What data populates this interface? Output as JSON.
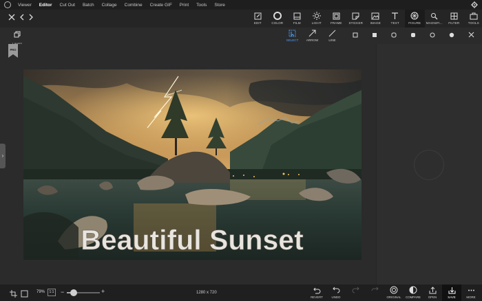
{
  "menu": {
    "items": [
      {
        "label": "Viewer"
      },
      {
        "label": "Editor"
      },
      {
        "label": "Cut Out"
      },
      {
        "label": "Batch"
      },
      {
        "label": "Collage"
      },
      {
        "label": "Combine"
      },
      {
        "label": "Create GIF"
      },
      {
        "label": "Print"
      },
      {
        "label": "Tools"
      },
      {
        "label": "Store"
      }
    ],
    "active": "Editor"
  },
  "toolbar": {
    "tools": [
      {
        "label": "EDIT",
        "icon": "edit-icon"
      },
      {
        "label": "COLOR",
        "icon": "color-icon"
      },
      {
        "label": "FILM",
        "icon": "film-icon"
      },
      {
        "label": "LIGHT",
        "icon": "light-icon"
      },
      {
        "label": "FRAME",
        "icon": "frame-icon"
      },
      {
        "label": "STICKER",
        "icon": "sticker-icon"
      },
      {
        "label": "IMAGE",
        "icon": "image-icon"
      },
      {
        "label": "TEXT",
        "icon": "text-icon"
      },
      {
        "label": "FIGURE",
        "icon": "figure-icon"
      },
      {
        "label": "MAGNIFI...",
        "icon": "magnifier-icon"
      },
      {
        "label": "FILTER",
        "icon": "filter-icon"
      },
      {
        "label": "TOOLS",
        "icon": "tools-icon"
      }
    ],
    "active": "FIGURE"
  },
  "subtools": [
    {
      "label": "SELECT",
      "icon": "select-icon"
    },
    {
      "label": "ARROW",
      "icon": "arrow-icon"
    },
    {
      "label": "LINE",
      "icon": "line-icon"
    }
  ],
  "layers": {
    "label": "Layers"
  },
  "badge": "PRO",
  "image_text": "Beautiful Sunset",
  "bottom": {
    "zoom": "79%",
    "ratio": "1:1",
    "zoom_level": 0.2,
    "dimensions": "1280 x 720",
    "actions": [
      {
        "label": "REVERT",
        "icon": "revert-icon",
        "enabled": true
      },
      {
        "label": "UNDO",
        "icon": "undo-icon",
        "enabled": true
      },
      {
        "label": "REDO",
        "icon": "redo-icon",
        "enabled": false
      },
      {
        "label": "REDO ALL",
        "icon": "redo-all-icon",
        "enabled": false
      },
      {
        "label": "ORIGINAL",
        "icon": "original-icon",
        "enabled": true
      },
      {
        "label": "COMPARE",
        "icon": "compare-icon",
        "enabled": true
      },
      {
        "label": "OPEN",
        "icon": "open-icon",
        "enabled": true
      },
      {
        "label": "SAVE",
        "icon": "save-icon",
        "enabled": true
      },
      {
        "label": "MORE",
        "icon": "more-icon",
        "enabled": true
      }
    ]
  },
  "colors": {
    "accent": "#4aa3ff",
    "panel": "#2b2b2b",
    "bar": "#1f1f1f"
  }
}
